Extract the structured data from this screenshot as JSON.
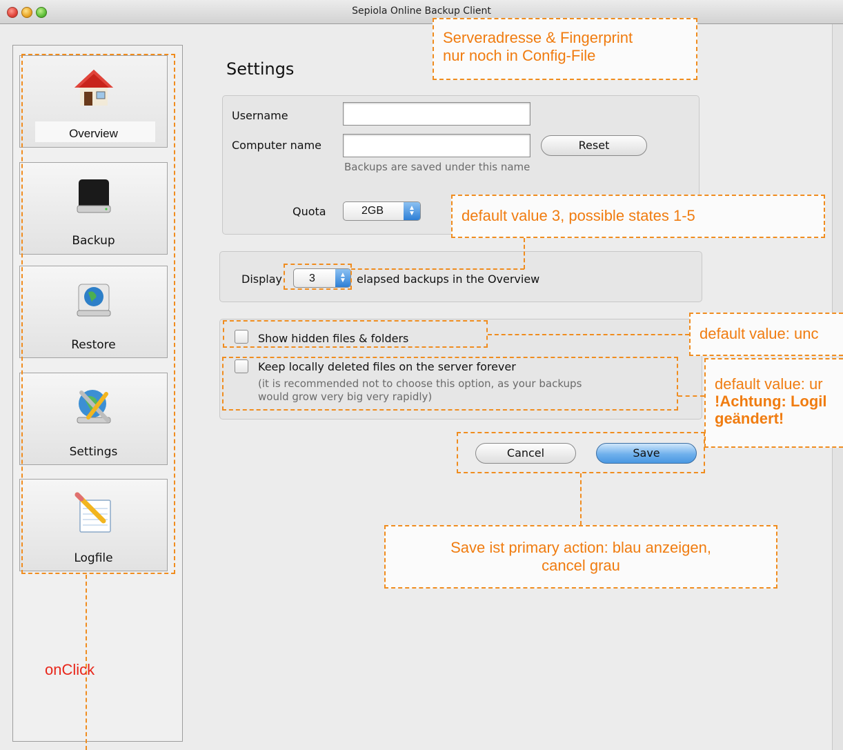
{
  "window": {
    "title": "Sepiola Online Backup Client"
  },
  "sidebar": {
    "items": [
      {
        "label": "Overview",
        "icon": "home-icon"
      },
      {
        "label": "Backup",
        "icon": "hard-drive-icon"
      },
      {
        "label": "Restore",
        "icon": "globe-drive-icon"
      },
      {
        "label": "Settings",
        "icon": "settings-tools-icon"
      },
      {
        "label": "Logfile",
        "icon": "notepad-pencil-icon"
      }
    ]
  },
  "settings": {
    "heading": "Settings",
    "username_label": "Username",
    "username_value": "",
    "computer_name_label": "Computer name",
    "computer_name_value": "",
    "reset_label": "Reset",
    "computer_hint": "Backups are saved under this name",
    "quota_label": "Quota",
    "quota_value": "2GB",
    "display_label": "Display",
    "display_value": "3",
    "display_suffix": "elapsed backups in the Overview",
    "hidden_files_label": "Show hidden files & folders",
    "keep_deleted_label": "Keep locally deleted files on the server forever",
    "keep_deleted_hint_1": "(it is recommended not to choose this option, as your backups",
    "keep_deleted_hint_2": "would grow very big very rapidly)",
    "cancel_label": "Cancel",
    "save_label": "Save"
  },
  "annotations": {
    "server_1": "Serveradresse & Fingerprint",
    "server_2": "nur noch in Config-File",
    "default_display": "default value 3, possible states 1-5",
    "default_hidden": "default value: unc",
    "default_keep_1": "default value: ur",
    "default_keep_2": "!Achtung: Logil",
    "default_keep_3": "geändert!",
    "save_primary_1": "Save ist primary action: blau anzeigen,",
    "save_primary_2": "cancel grau",
    "onclick": "onClick"
  },
  "colors": {
    "annotation": "#f08c1e",
    "onclick_text": "#e8261a",
    "primary_button": "#4a98e2"
  }
}
